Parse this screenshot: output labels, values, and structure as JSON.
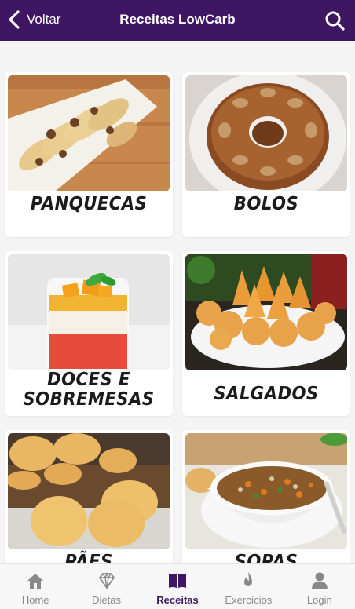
{
  "header": {
    "back_label": "Voltar",
    "title": "Receitas LowCarb",
    "background": "#3f1664"
  },
  "categories": [
    {
      "label": "PANQUECAS"
    },
    {
      "label": "BOLOS"
    },
    {
      "label_line1": "DOCES E",
      "label_line2": "SOBREMESAS"
    },
    {
      "label": "SALGADOS"
    },
    {
      "label": "PÃES"
    },
    {
      "label": "SOPAS"
    }
  ],
  "nav": {
    "items": [
      {
        "label": "Home",
        "icon": "home-icon"
      },
      {
        "label": "Dietas",
        "icon": "diamond-icon"
      },
      {
        "label": "Receitas",
        "icon": "book-icon"
      },
      {
        "label": "Exercícios",
        "icon": "flame-icon"
      },
      {
        "label": "Login",
        "icon": "user-icon"
      }
    ],
    "active": "Receitas",
    "active_color": "#3f1664",
    "inactive_color": "#888888"
  }
}
